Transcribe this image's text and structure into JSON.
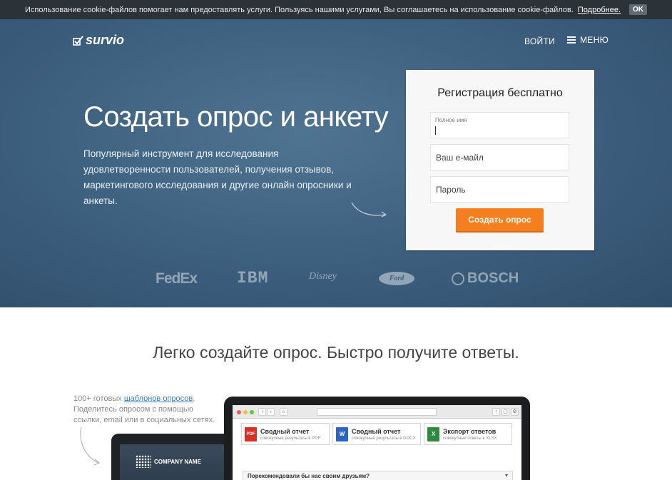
{
  "cookie": {
    "text": "Использование cookie-файлов помогает нам предоставлять услуги. Пользуясь нашими услугами, Вы соглашаетесь на использование cookie-файлов.",
    "more_link": "Подробнее.",
    "ok_button": "OK"
  },
  "header": {
    "logo_text": "survio",
    "login_label": "ВОЙТИ",
    "menu_label": "МЕНЮ"
  },
  "hero": {
    "title": "Создать опрос и анкету",
    "description": "Популярный инструмент для исследования удовлетворенности пользователей, получения отзывов, маркетингового исследования и другие онлайн опросники и анкеты."
  },
  "signup": {
    "title": "Регистрация бесплатно",
    "fullname_label": "Полное имя",
    "email_placeholder": "Ваш e-майл",
    "password_placeholder": "Пароль",
    "submit_label": "Создать опрос"
  },
  "brands": [
    "FedEx",
    "IBM",
    "Disney",
    "Ford",
    "BOSCH"
  ],
  "section": {
    "title": "Легко создайте опрос. Быстро получите ответы.",
    "feature_prefix": "100+ готовых ",
    "feature_link": "шаблонов опросов",
    "feature_suffix": ".",
    "feature_line2": "Поделитесь опросом с помощью ссылки, email или в социальных сетях."
  },
  "mock": {
    "company_name": "COMPANY NAME",
    "cards": [
      {
        "icon": "PDF",
        "title": "Сводный отчет",
        "subtitle": "совокупные результаты в PDF",
        "color": "#d93025"
      },
      {
        "icon": "W",
        "title": "Сводный отчет",
        "subtitle": "совокупные результаты в DOCX",
        "color": "#2b63c6"
      },
      {
        "icon": "X",
        "title": "Экспорт ответов",
        "subtitle": "совокупные ответы в XLSX",
        "color": "#2e8b3e"
      }
    ],
    "question": "Порекомендовали бы нас своим друзьям?"
  },
  "colors": {
    "hero_bg": "#3f6281",
    "accent_orange": "#f57f1f",
    "cookie_bar_bg": "#2b3238"
  }
}
